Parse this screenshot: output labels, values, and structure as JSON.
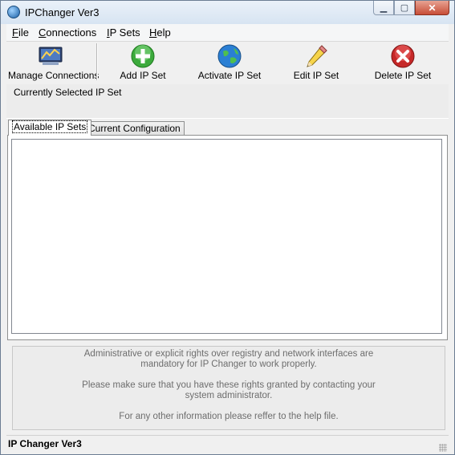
{
  "window": {
    "title": "IPChanger Ver3",
    "minimize_glyph": "▁",
    "maximize_glyph": "▢",
    "close_glyph": "✕"
  },
  "menu": {
    "items": [
      {
        "accel": "F",
        "rest": "ile"
      },
      {
        "accel": "C",
        "rest": "onnections"
      },
      {
        "accel": "I",
        "rest": "P Sets"
      },
      {
        "accel": "H",
        "rest": "elp"
      }
    ]
  },
  "toolbar": {
    "buttons": [
      {
        "label": "Manage Connections",
        "icon": "network-connections-icon"
      },
      {
        "label": "Add IP Set",
        "icon": "add-plus-icon"
      },
      {
        "label": "Activate IP Set",
        "icon": "globe-activate-icon"
      },
      {
        "label": "Edit IP Set",
        "icon": "pencil-edit-icon"
      },
      {
        "label": "Delete IP Set",
        "icon": "delete-x-icon"
      }
    ]
  },
  "selected": {
    "label": "Currently Selected IP Set"
  },
  "tabs": [
    {
      "label": "Available IP Sets",
      "active": true
    },
    {
      "label": "Current Configuration",
      "active": false
    }
  ],
  "info": {
    "line1": "Administrative or explicit rights over registry and network interfaces are",
    "line2": "mandatory for IP Changer to work properly.",
    "line3": "Please make sure that you have these rights granted by contacting your",
    "line4": "system administrator.",
    "line5": "For any other information please reffer to the help file."
  },
  "status": {
    "text": "IP Changer Ver3"
  },
  "colors": {
    "accent": "#1a5fa5",
    "close": "#c74d37",
    "add": "#3caa3c",
    "delete": "#c62828"
  }
}
